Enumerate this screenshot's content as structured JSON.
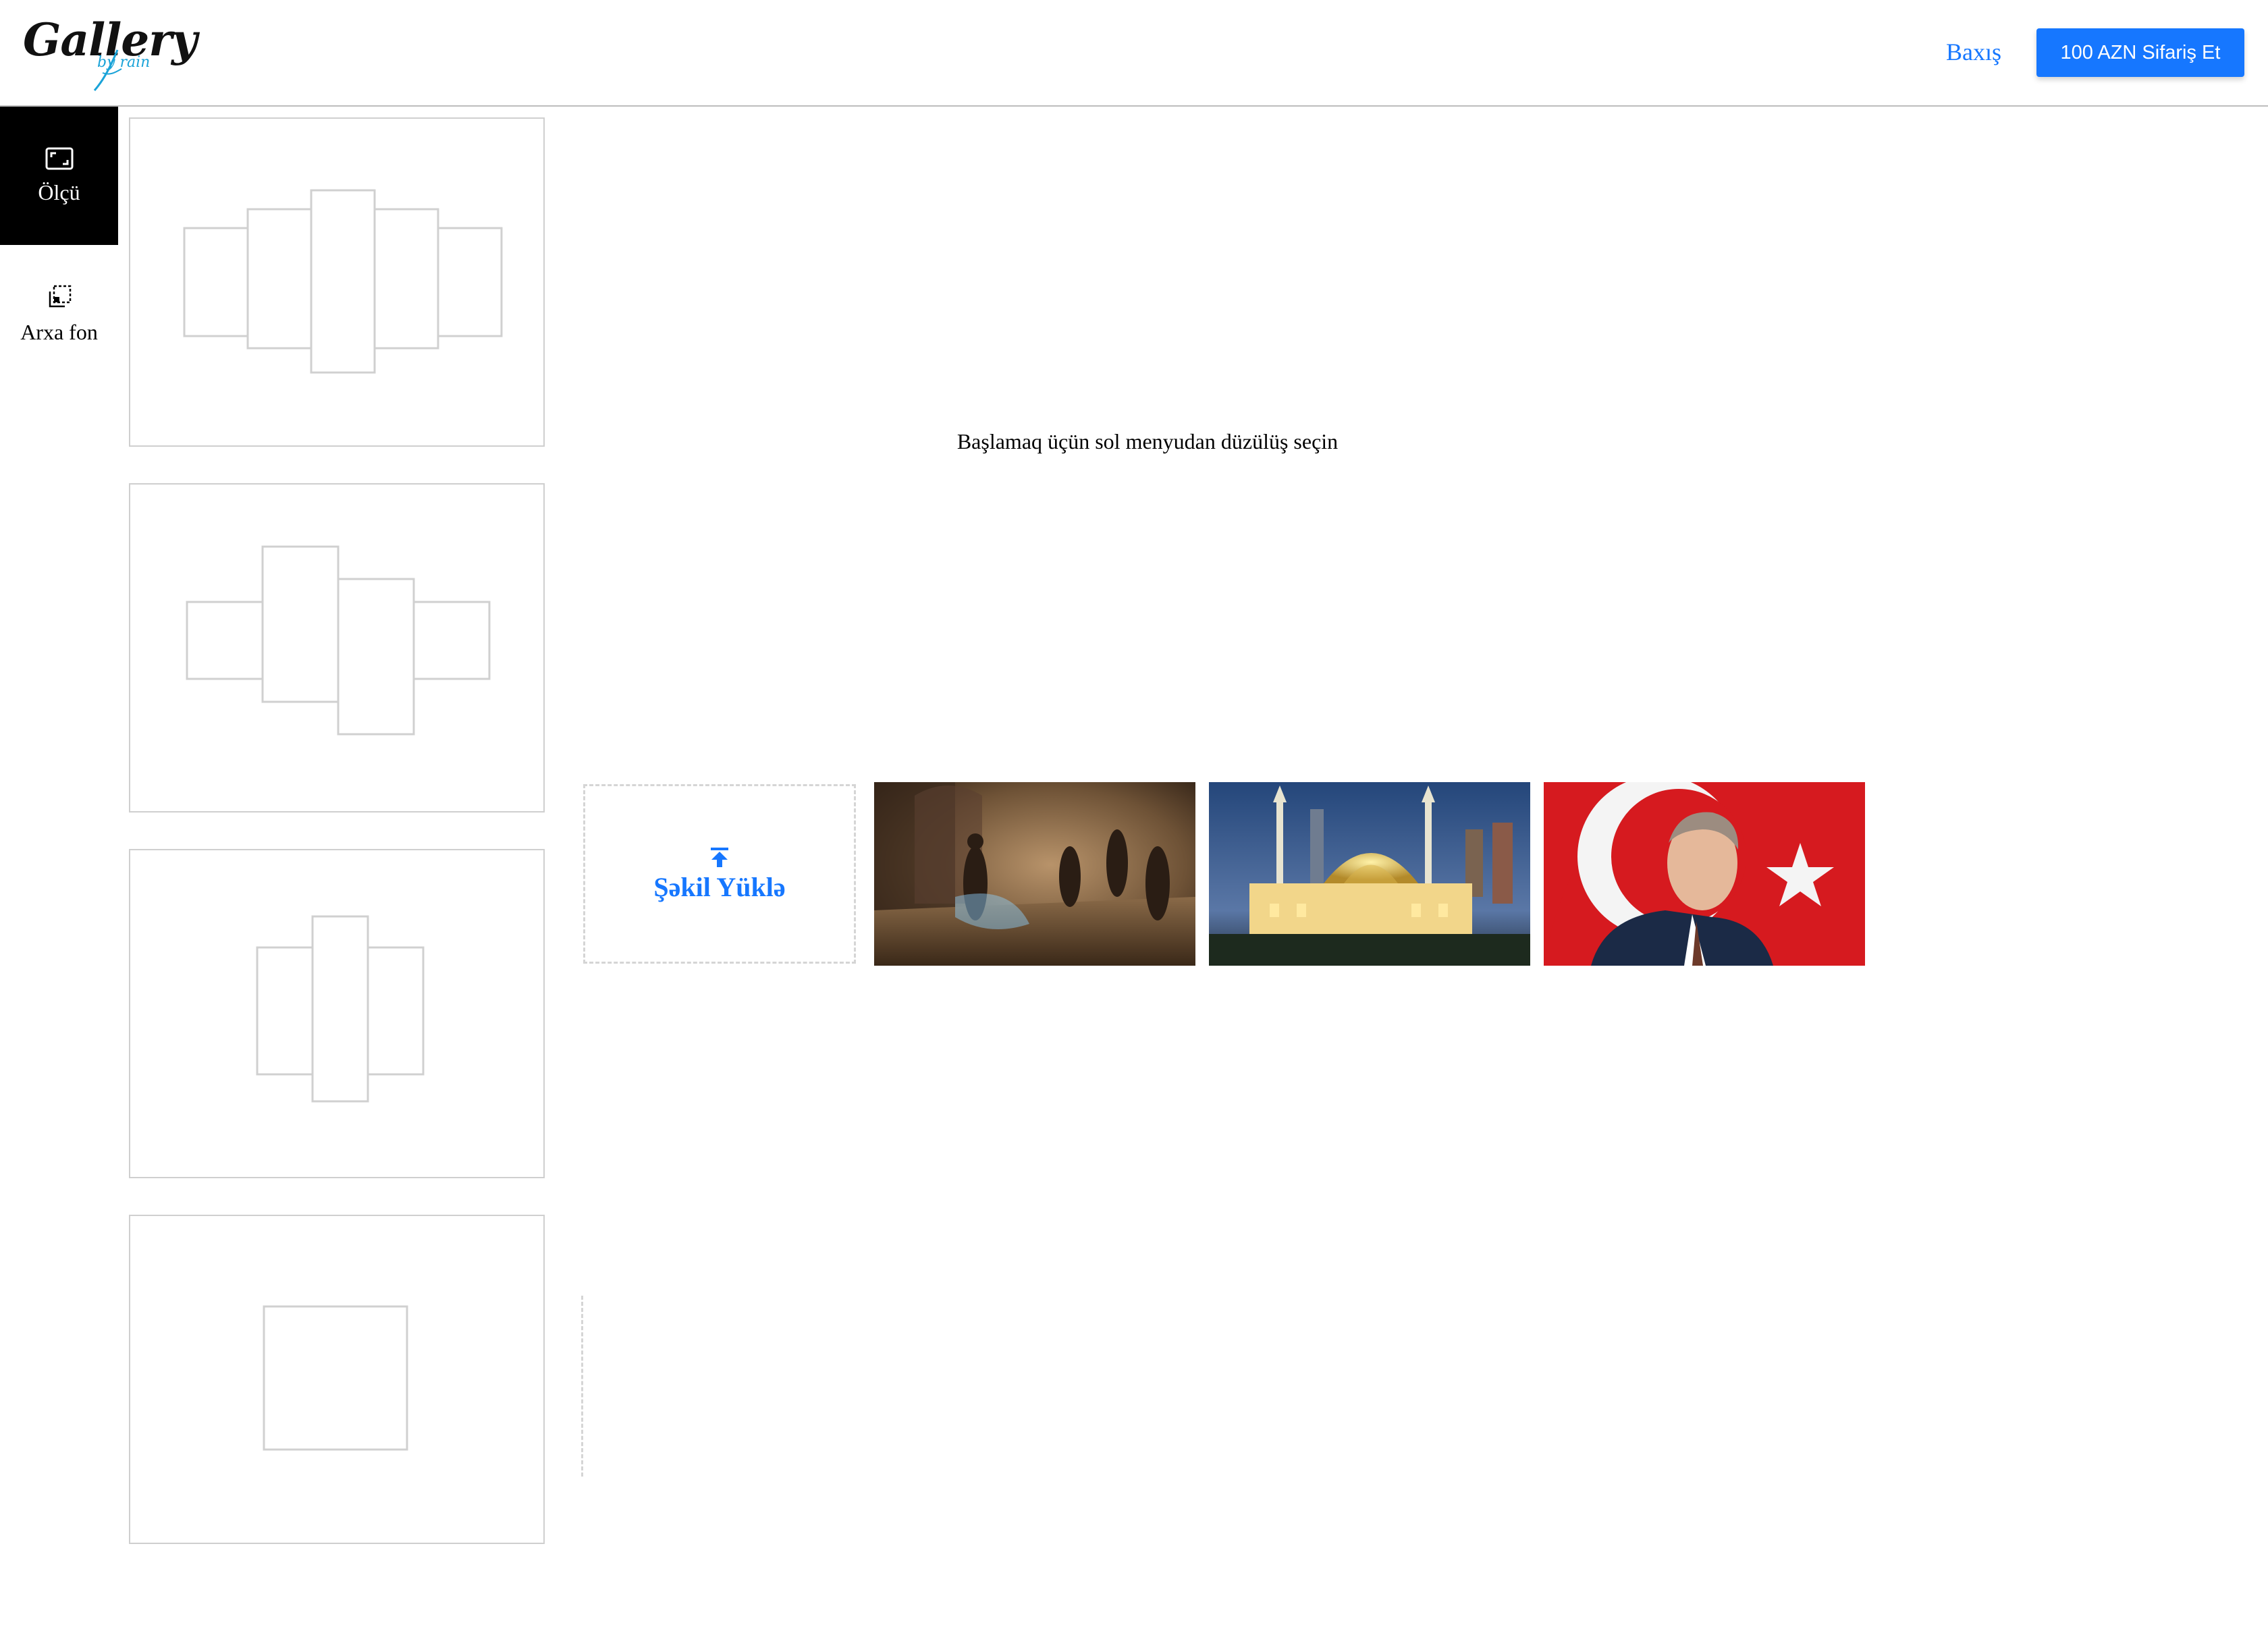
{
  "header": {
    "logo_text": "Gallery",
    "logo_sub": "by rain",
    "preview_label": "Baxış",
    "order_button_label": "100 AZN Sifariş Et",
    "accent_color": "#1677ff"
  },
  "rail": {
    "items": [
      {
        "label": "Ölçü",
        "icon": "resize-icon",
        "active": true
      },
      {
        "label": "Arxa fon",
        "icon": "background-layers-icon",
        "active": false
      }
    ]
  },
  "layouts": [
    {
      "name": "five-panel-layout",
      "panels": 5
    },
    {
      "name": "four-panel-layout",
      "panels": 4
    },
    {
      "name": "three-panel-layout",
      "panels": 3
    },
    {
      "name": "single-panel-layout",
      "panels": 1
    }
  ],
  "canvas": {
    "placeholder_text": "Başlamaq üçün sol menyudan düzülüş seçin"
  },
  "images": {
    "upload_label": "Şəkil Yüklə",
    "upload_icon": "upload-arrow-icon",
    "thumbnails": [
      {
        "name": "prince-of-persia-image"
      },
      {
        "name": "mosque-at-night-image"
      },
      {
        "name": "ataturk-turkish-flag-image"
      }
    ]
  }
}
